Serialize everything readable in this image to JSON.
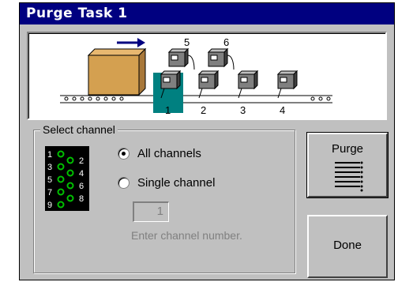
{
  "window": {
    "title": "Purge Task 1"
  },
  "illustration": {
    "channels_bottom": [
      "1",
      "2",
      "3",
      "4"
    ],
    "channels_top": [
      "5",
      "6"
    ],
    "selected_channel": "1",
    "colors": {
      "box": "#d4a050",
      "arrow": "#000080",
      "highlight": "#008080"
    }
  },
  "select_group": {
    "legend": "Select channel",
    "connector_pins_left": [
      "1",
      "3",
      "5",
      "7",
      "9"
    ],
    "connector_pins_right": [
      "2",
      "4",
      "6",
      "8"
    ],
    "all_channels_label": "All channels",
    "single_channel_label": "Single channel",
    "selected_option": "All channels",
    "channel_value": "1",
    "channel_hint": "Enter channel number."
  },
  "buttons": {
    "purge_label": "Purge",
    "done_label": "Done"
  }
}
